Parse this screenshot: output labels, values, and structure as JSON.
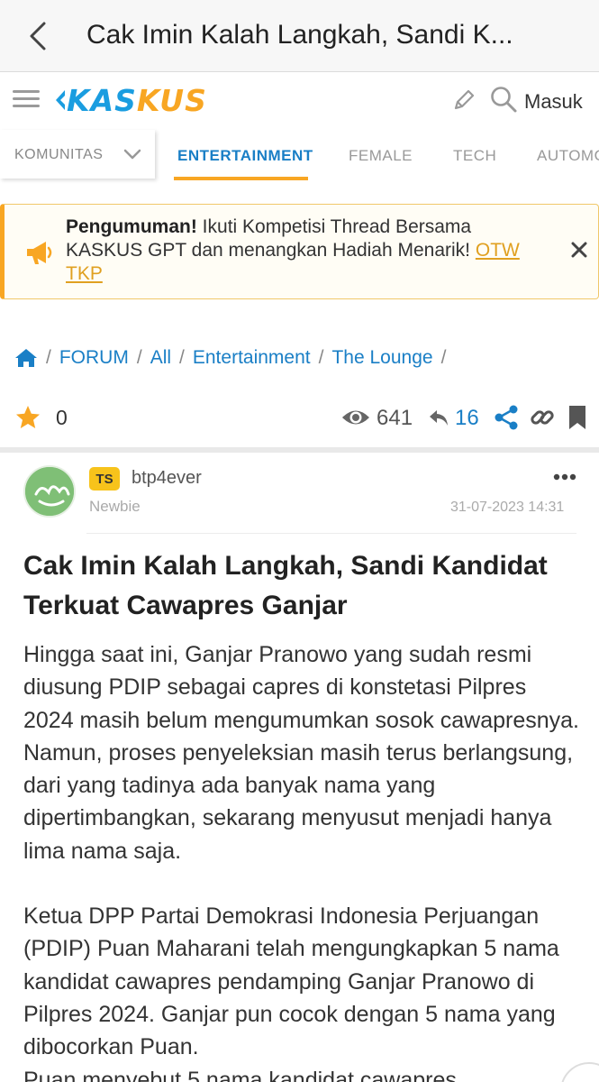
{
  "appbar": {
    "title": "Cak Imin Kalah Langkah, Sandi K..."
  },
  "site": {
    "logo_part1": "KAS",
    "logo_part2": "KUS",
    "login_label": "Masuk"
  },
  "nav": {
    "komunitas": "KOMUNITAS",
    "tabs": [
      {
        "label": "ENTERTAINMENT",
        "active": true
      },
      {
        "label": "FEMALE",
        "active": false
      },
      {
        "label": "TECH",
        "active": false
      },
      {
        "label": "AUTOMO",
        "active": false
      }
    ]
  },
  "announcement": {
    "bold": "Pengumuman!",
    "text": " Ikuti Kompetisi Thread Bersama KASKUS GPT dan menangkan Hadiah Menarik! ",
    "link": "OTW TKP"
  },
  "breadcrumb": {
    "items": [
      "FORUM",
      "All",
      "Entertainment",
      "The Lounge"
    ],
    "separator": "/"
  },
  "stats": {
    "stars": "0",
    "views": "641",
    "replies": "16"
  },
  "post": {
    "badge": "TS",
    "username": "btp4ever",
    "rank": "Newbie",
    "date": "31-07-2023 14:31",
    "title": "Cak Imin Kalah Langkah, Sandi Kandidat Terkuat Cawapres Ganjar",
    "paragraph1": "Hingga saat ini, Ganjar Pranowo yang sudah resmi diusung PDIP sebagai capres di konstetasi Pilpres 2024 masih belum mengumumkan sosok cawapresnya. Namun, proses penyeleksian masih terus berlangsung, dari yang tadinya ada banyak nama yang dipertimbangkan, sekarang menyusut menjadi hanya lima nama saja.",
    "paragraph2": "Ketua DPP Partai Demokrasi Indonesia Perjuangan (PDIP) Puan Maharani telah mengungkapkan 5 nama kandidat cawapres pendamping Ganjar Pranowo di Pilpres 2024. Ganjar pun cocok dengan 5 nama yang dibocorkan Puan.",
    "paragraph3": "Puan menyebut 5 nama kandidat cawapres"
  },
  "colors": {
    "brand_blue": "#1a9de0",
    "brand_orange": "#f8a623",
    "link_blue": "#1a7fc6"
  }
}
